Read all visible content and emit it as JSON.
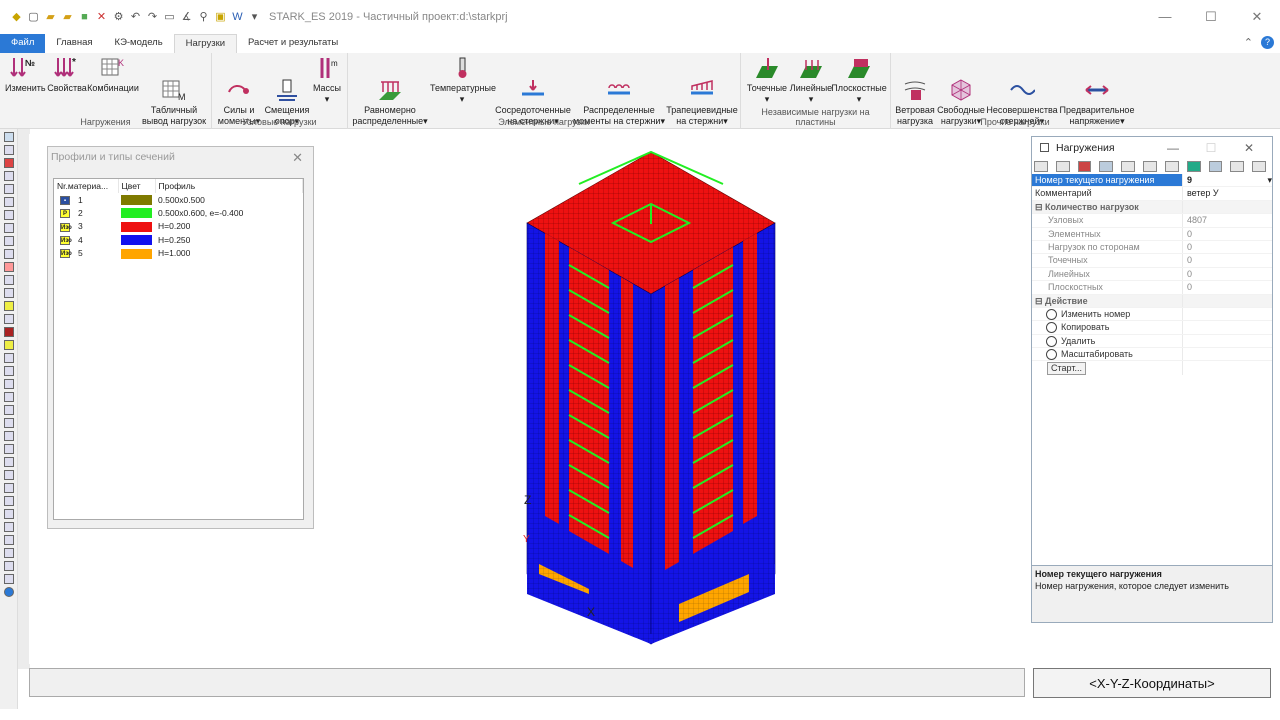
{
  "window": {
    "title": "STARK_ES 2019 - Частичный проект:d:\\starkprj",
    "controls": [
      "—",
      "☐",
      "✕"
    ]
  },
  "menu": {
    "tabs": [
      "Файл",
      "Главная",
      "КЭ-модель",
      "Нагрузки",
      "Расчет и результаты"
    ],
    "active_tab": "Нагрузки"
  },
  "ribbon": {
    "groups": [
      {
        "label": "Нагружения",
        "buttons": [
          "Изменить",
          "Свойства",
          "Комбинации",
          "Табличный\nвывод нагрузок"
        ]
      },
      {
        "label": "Узловые нагрузки",
        "buttons": [
          "Силы и\nмоменты",
          "Смещения\nопор",
          "Массы"
        ]
      },
      {
        "label": "Элементные нагрузки",
        "buttons": [
          "Равномерно\nраспределенные",
          "Температурные",
          "Сосредоточенные\nна стержни",
          "Распределенные\nмоменты на стержни",
          "Трапециевидные\nна стержни"
        ]
      },
      {
        "label": "Независимые нагрузки на пластины",
        "buttons": [
          "Точечные",
          "Линейные",
          "Плоскостные"
        ]
      },
      {
        "label": "Прочие нагрузки",
        "buttons": [
          "Ветровая\nнагрузка",
          "Свободные\nнагрузки",
          "Несовершенства\nстержней",
          "Предварительное\nнапряжение"
        ]
      }
    ]
  },
  "profiles_panel": {
    "title": "Профили и типы сечений",
    "columns": [
      "Nr.материа...",
      "Цвет",
      "Профиль"
    ],
    "rows": [
      {
        "nr": "1",
        "badge": "▪",
        "color": "#7f7a00",
        "profile": "0.500x0.500"
      },
      {
        "nr": "2",
        "badge": "P",
        "color": "#22ee22",
        "profile": "0.500x0.600, e=-0.400"
      },
      {
        "nr": "3",
        "badge": "Изо",
        "color": "#ee1111",
        "profile": "H=0.200"
      },
      {
        "nr": "4",
        "badge": "Изо",
        "color": "#1111ee",
        "profile": "H=0.250"
      },
      {
        "nr": "5",
        "badge": "Изо",
        "color": "#ffa500",
        "profile": "H=1.000"
      }
    ]
  },
  "model": {
    "axis_labels": [
      "Z",
      "Y",
      "X"
    ]
  },
  "loads_panel": {
    "title": "Нагружения",
    "current_label": "Номер текущего нагружения",
    "current_value": "9",
    "comment_label": "Комментарий",
    "comment_value": "ветер У",
    "count_category": "Количество нагрузок",
    "counts": [
      {
        "label": "Узловых",
        "value": "4807"
      },
      {
        "label": "Элементных",
        "value": "0"
      },
      {
        "label": "Нагрузок по сторонам",
        "value": "0"
      },
      {
        "label": "Точечных",
        "value": "0"
      },
      {
        "label": "Линейных",
        "value": "0"
      },
      {
        "label": "Плоскостных",
        "value": "0"
      }
    ],
    "action_category": "Действие",
    "actions": [
      "Изменить номер",
      "Копировать",
      "Удалить",
      "Масштабировать"
    ],
    "start_button": "Старт...",
    "help_title": "Номер текущего нагружения",
    "help_text": "Номер нагружения, которое следует изменить"
  },
  "status": {
    "coords_label": "<X-Y-Z-Координаты>"
  }
}
